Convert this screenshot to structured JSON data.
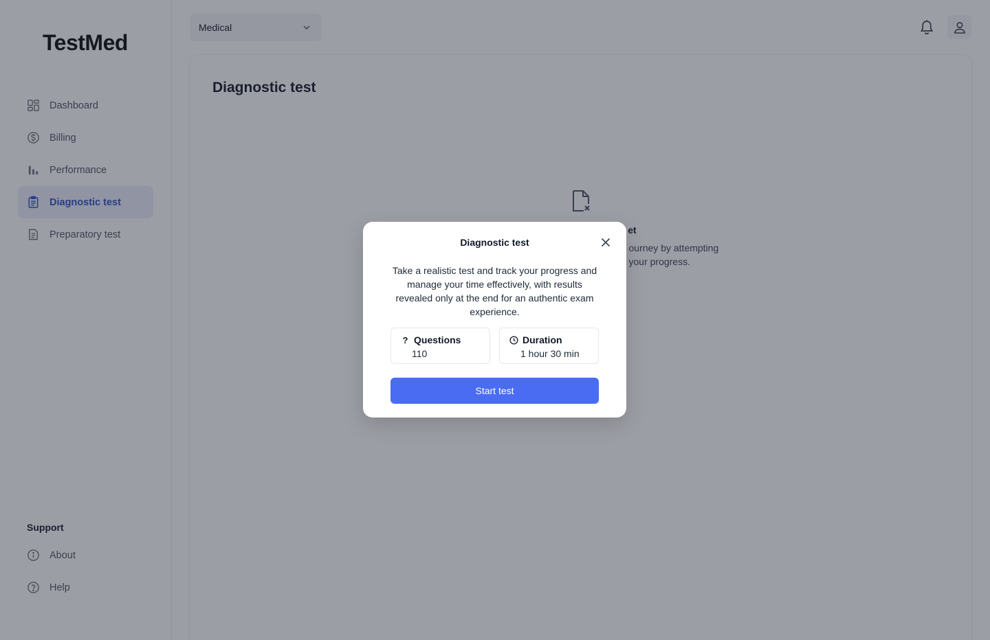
{
  "app": {
    "logo": "TestMed"
  },
  "sidebar": {
    "items": [
      {
        "label": "Dashboard",
        "icon": "dashboard-grid-icon"
      },
      {
        "label": "Billing",
        "icon": "dollar-circle-icon"
      },
      {
        "label": "Performance",
        "icon": "bar-chart-icon"
      },
      {
        "label": "Diagnostic test",
        "icon": "clipboard-icon",
        "active": true
      },
      {
        "label": "Preparatory test",
        "icon": "document-icon"
      }
    ],
    "support_title": "Support",
    "support_items": [
      {
        "label": "About",
        "icon": "info-circle-icon"
      },
      {
        "label": "Help",
        "icon": "question-circle-icon"
      }
    ]
  },
  "topbar": {
    "category_select": {
      "value": "Medical"
    },
    "notifications_icon": "bell-icon",
    "profile_icon": "user-icon"
  },
  "main": {
    "title": "Diagnostic test",
    "empty_state": {
      "icon": "file-x-icon",
      "title": "et",
      "text_line1": "ourney by attempting",
      "text_line2": "your progress."
    }
  },
  "modal": {
    "title": "Diagnostic test",
    "description": "Take a realistic test and track your progress and manage your time effectively, with results revealed only at the end for an authentic exam experience.",
    "questions": {
      "label": "Questions",
      "value": "110",
      "icon": "question-mark-icon"
    },
    "duration": {
      "label": "Duration",
      "value": "1 hour 30 min",
      "icon": "clock-icon"
    },
    "start_label": "Start test",
    "close_icon": "close-icon"
  },
  "colors": {
    "accent": "#4a6cf3",
    "active_nav_bg": "#e9edfb",
    "active_nav_text": "#2f4fc9",
    "overlay": "rgba(35,40,55,0.45)"
  }
}
